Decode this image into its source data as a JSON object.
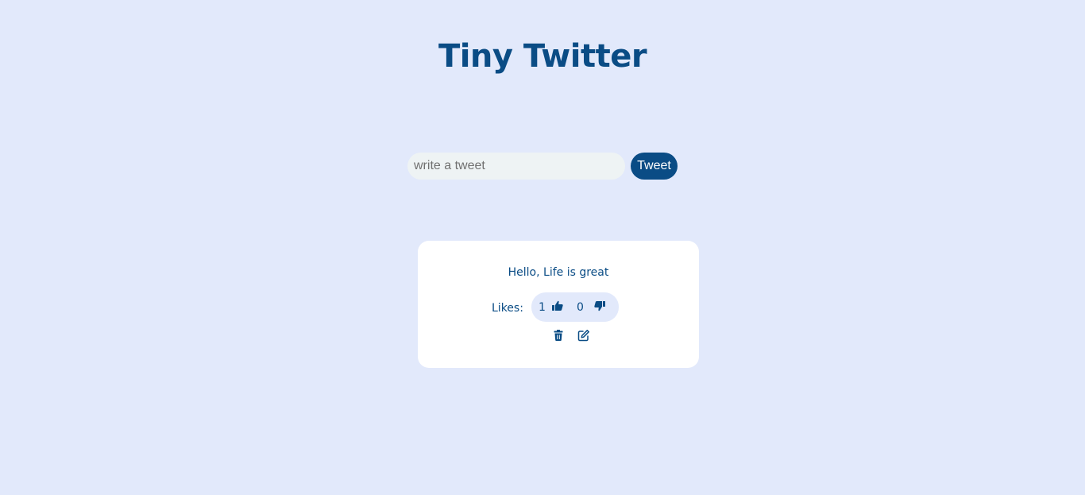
{
  "header": {
    "title": "Tiny Twitter"
  },
  "compose": {
    "placeholder": "write a tweet",
    "value": "",
    "button_label": "Tweet"
  },
  "tweets": [
    {
      "text": "Hello, Life is great",
      "likes_label": "Likes:",
      "like_count": "1",
      "dislike_count": "0",
      "icons": [
        "thumbs-up-icon",
        "thumbs-down-icon",
        "trash-icon",
        "edit-icon"
      ]
    }
  ],
  "colors": {
    "background": "#e2e9fb",
    "primary": "#0a4c85",
    "card": "#ffffff",
    "input": "#eef3f4"
  }
}
